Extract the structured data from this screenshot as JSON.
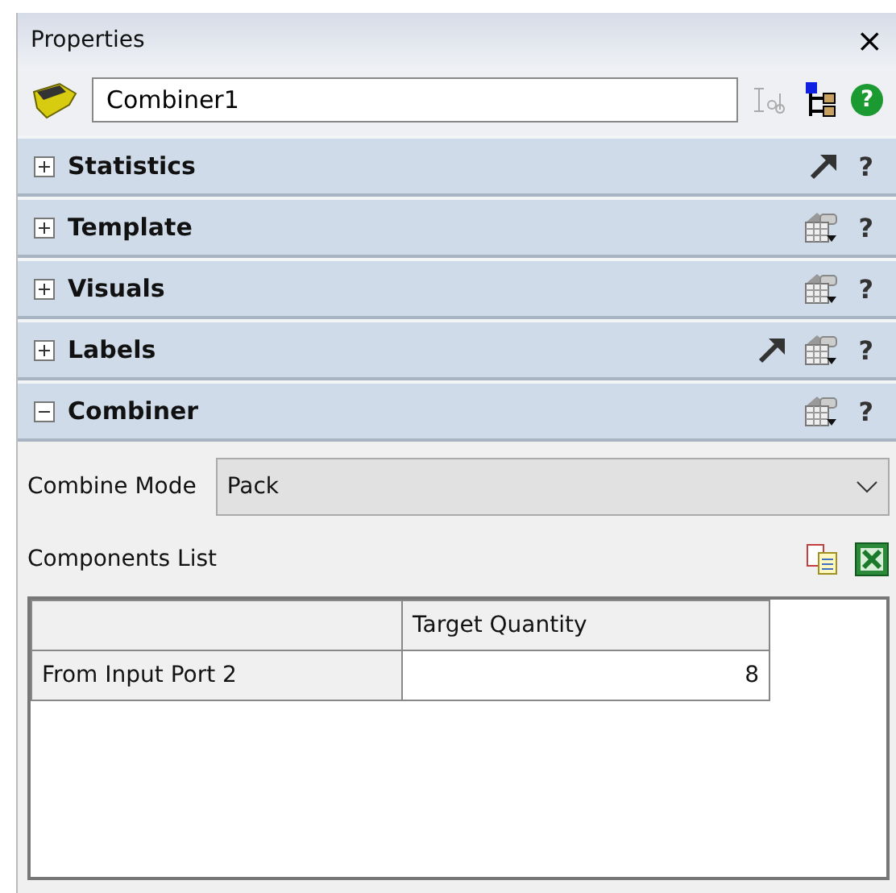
{
  "window": {
    "title": "Properties",
    "close": "×"
  },
  "toolbar": {
    "name_value": "Combiner1",
    "help": "?"
  },
  "sections": [
    {
      "title": "Statistics",
      "expanded": false,
      "pointer": true,
      "options": false,
      "help": "?"
    },
    {
      "title": "Template",
      "expanded": false,
      "pointer": false,
      "options": true,
      "help": "?"
    },
    {
      "title": "Visuals",
      "expanded": false,
      "pointer": false,
      "options": true,
      "help": "?"
    },
    {
      "title": "Labels",
      "expanded": false,
      "pointer": true,
      "options": true,
      "help": "?"
    },
    {
      "title": "Combiner",
      "expanded": true,
      "pointer": false,
      "options": true,
      "help": "?"
    }
  ],
  "combine_mode": {
    "label": "Combine Mode",
    "value": "Pack"
  },
  "components": {
    "label": "Components List",
    "columns": [
      "",
      "Target Quantity"
    ],
    "rows": [
      {
        "header": "From Input Port 2",
        "values": [
          "8"
        ]
      }
    ]
  }
}
